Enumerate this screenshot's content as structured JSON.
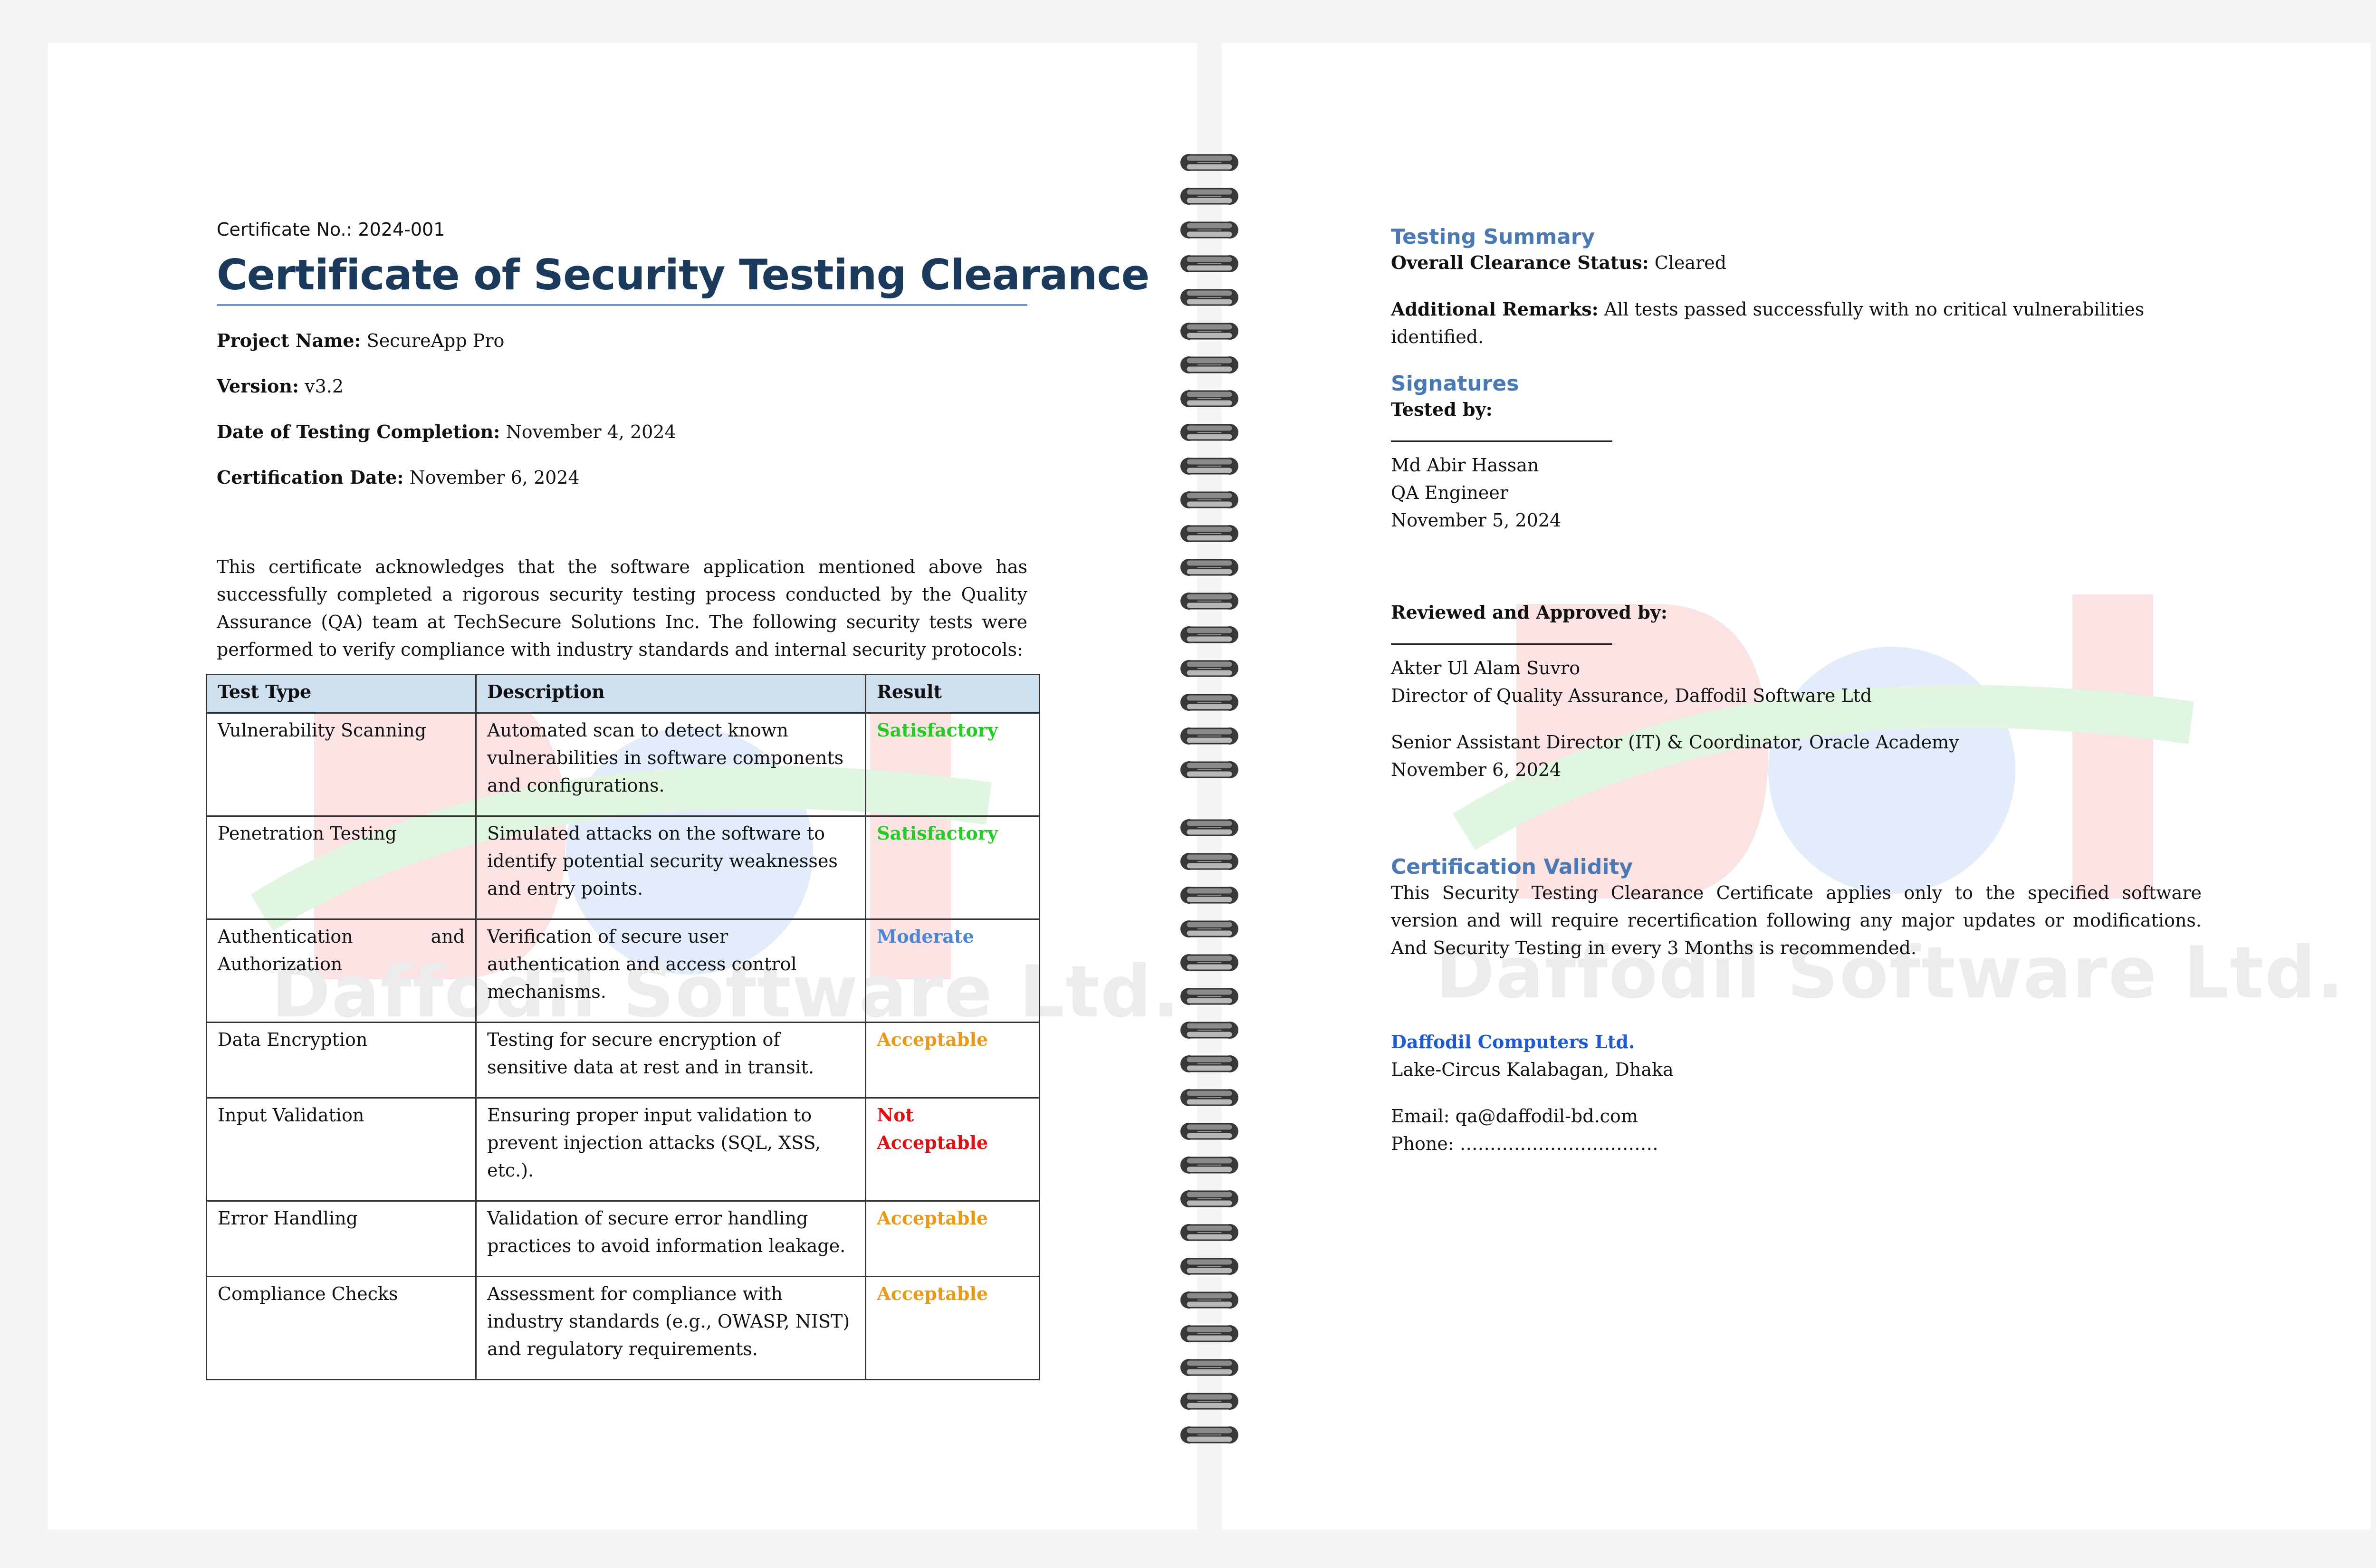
{
  "certificate": {
    "number_label": "Certificate No.: 2024-001",
    "title": "Certificate of Security Testing Clearance",
    "fields": [
      {
        "label": "Project Name:",
        "value": "SecureApp Pro"
      },
      {
        "label": "Version:",
        "value": "v3.2"
      },
      {
        "label": "Date of Testing Completion:",
        "value": "November 4, 2024"
      },
      {
        "label": "Certification Date:",
        "value": "November 6, 2024"
      }
    ],
    "intro": "This certificate acknowledges that the software application mentioned above has successfully completed a rigorous security testing process conducted by the Quality Assurance (QA) team at TechSecure Solutions Inc. The following security tests were performed to verify compliance with industry standards and internal security protocols:"
  },
  "table": {
    "headers": [
      "Test Type",
      "Description",
      "Result"
    ],
    "rows": [
      {
        "type": "Vulnerability Scanning",
        "description": "Automated scan to detect known vulnerabilities in software components and configurations.",
        "result": "Satisfactory"
      },
      {
        "type": "Penetration Testing",
        "description": "Simulated attacks on the software to identify potential security weaknesses and entry points.",
        "result": "Satisfactory"
      },
      {
        "type": "Authentication and Authorization",
        "description": "Verification of secure user authentication and access control mechanisms.",
        "result": "Moderate"
      },
      {
        "type": "Data Encryption",
        "description": "Testing for secure encryption of sensitive data at rest and in transit.",
        "result": "Acceptable"
      },
      {
        "type": "Input Validation",
        "description": "Ensuring proper input validation to prevent injection attacks (SQL, XSS, etc.).",
        "result": "Not Acceptable"
      },
      {
        "type": "Error Handling",
        "description": "Validation of secure error handling practices to avoid information leakage.",
        "result": "Acceptable"
      },
      {
        "type": "Compliance Checks",
        "description": "Assessment for compliance with industry standards (e.g., OWASP, NIST) and regulatory requirements.",
        "result": "Acceptable"
      }
    ]
  },
  "summary": {
    "heading": "Testing Summary",
    "status_label": "Overall Clearance Status:",
    "status_value": "Cleared",
    "remarks_label": "Additional Remarks:",
    "remarks_value": "All tests passed successfully with no critical vulnerabilities identified."
  },
  "signatures": {
    "heading": "Signatures",
    "tested_by_label": "Tested by:",
    "tester_name": "Md Abir Hassan",
    "tester_role": "QA Engineer",
    "tester_date": "November 5, 2024",
    "reviewed_label": "Reviewed and Approved by:",
    "reviewer_name": "Akter Ul Alam Suvro",
    "reviewer_role1": "Director of Quality Assurance, Daffodil Software Ltd",
    "reviewer_role2": "Senior Assistant Director (IT) & Coordinator, Oracle Academy",
    "reviewer_date": "November 6, 2024"
  },
  "validity": {
    "heading": "Certification Validity",
    "text": "This Security Testing Clearance Certificate applies only to the specified software version and will require recertification following any major updates or modifications. And Security Testing in every 3 Months is recommended."
  },
  "company": {
    "name": "Daffodil Computers Ltd.",
    "address": "Lake-Circus Kalabagan, Dhaka",
    "email": "Email: qa@daffodil-bd.com",
    "phone": "Phone: ……………………………"
  },
  "watermark": {
    "text": "Daffodil Software Ltd.",
    "colors": {
      "red": "#fbe3e3",
      "blue": "#e2ecfb",
      "green": "#e0f6e0"
    }
  },
  "colors": {
    "title": "#1b3a5c",
    "heading": "#4a79b3",
    "table_header": "#cfe0f0",
    "satisfactory": "#22cc22",
    "moderate": "#4a86d4",
    "acceptable": "#e89a18",
    "not_acceptable": "#dd1111",
    "company": "#1f5ad1"
  }
}
